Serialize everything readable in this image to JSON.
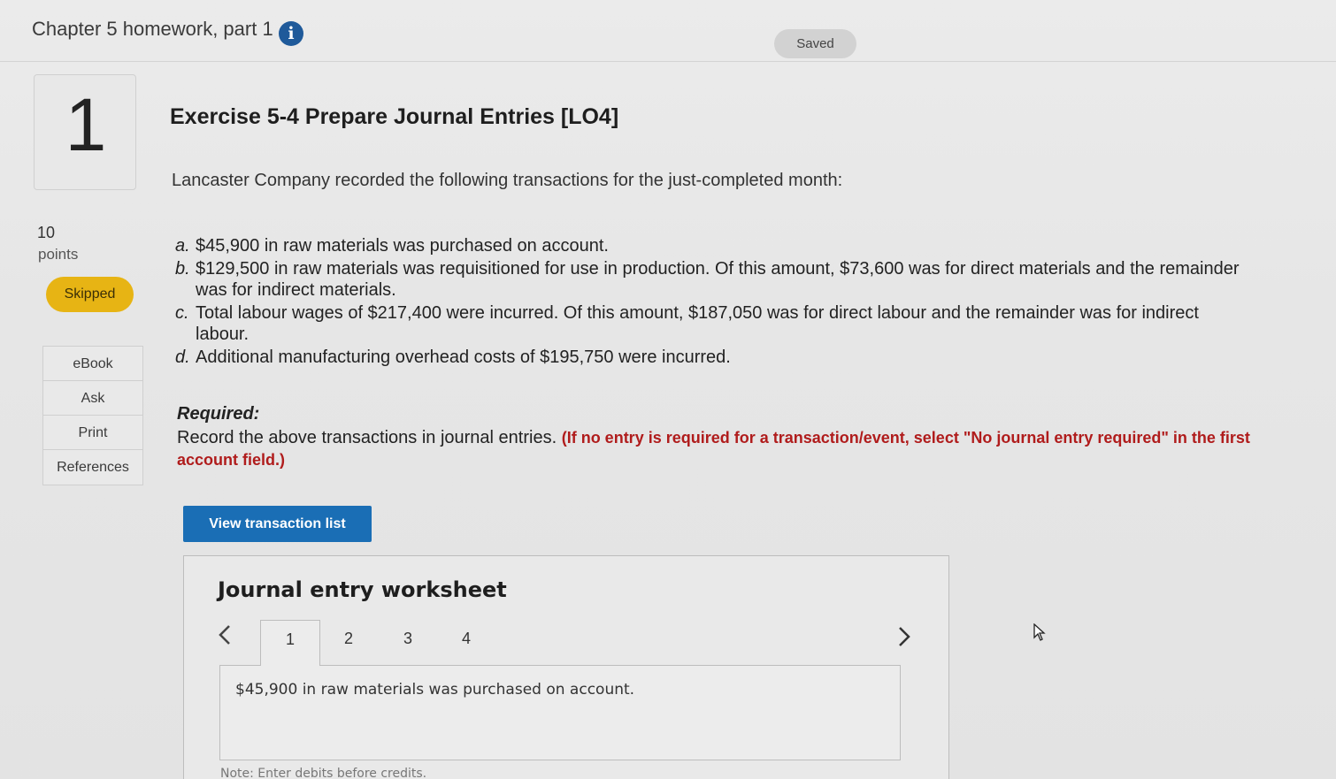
{
  "header": {
    "title": "Chapter 5 homework, part 1",
    "info_icon": "info-icon",
    "status": "Saved"
  },
  "question": {
    "number": "1",
    "points_value": "10",
    "points_label": "points",
    "status_badge": "Skipped"
  },
  "side_menu": {
    "items": [
      {
        "label": "eBook"
      },
      {
        "label": "Ask"
      },
      {
        "label": "Print"
      },
      {
        "label": "References"
      }
    ]
  },
  "exercise": {
    "title": "Exercise 5-4 Prepare Journal Entries [LO4]",
    "intro": "Lancaster Company recorded the following transactions for the just-completed month:",
    "transactions": [
      {
        "letter": "a.",
        "text": "$45,900 in raw materials was purchased on account."
      },
      {
        "letter": "b.",
        "text": "$129,500 in raw materials was requisitioned for use in production. Of this amount, $73,600 was for direct materials and the remainder was for indirect materials."
      },
      {
        "letter": "c.",
        "text": "Total labour wages of $217,400 were incurred. Of this amount, $187,050 was for direct labour and the remainder was for indirect labour."
      },
      {
        "letter": "d.",
        "text": "Additional manufacturing overhead costs of $195,750 were incurred."
      }
    ],
    "required_label": "Required:",
    "required_text": "Record the above transactions in journal entries.",
    "required_note": "(If no entry is required for a transaction/event, select \"No journal entry required\" in the first account field.)"
  },
  "actions": {
    "view_transactions": "View transaction list"
  },
  "worksheet": {
    "title": "Journal entry worksheet",
    "prev_icon": "chevron-left-icon",
    "next_icon": "chevron-right-icon",
    "tabs": [
      "1",
      "2",
      "3",
      "4"
    ],
    "active_tab": "1",
    "description": "$45,900 in raw materials was purchased on account.",
    "note": "Note: Enter debits before credits."
  },
  "colors": {
    "accent_blue": "#1a6eb5",
    "info_blue": "#1f5a9a",
    "skipped_yellow": "#e7b414",
    "instruction_red": "#b01c1c"
  }
}
